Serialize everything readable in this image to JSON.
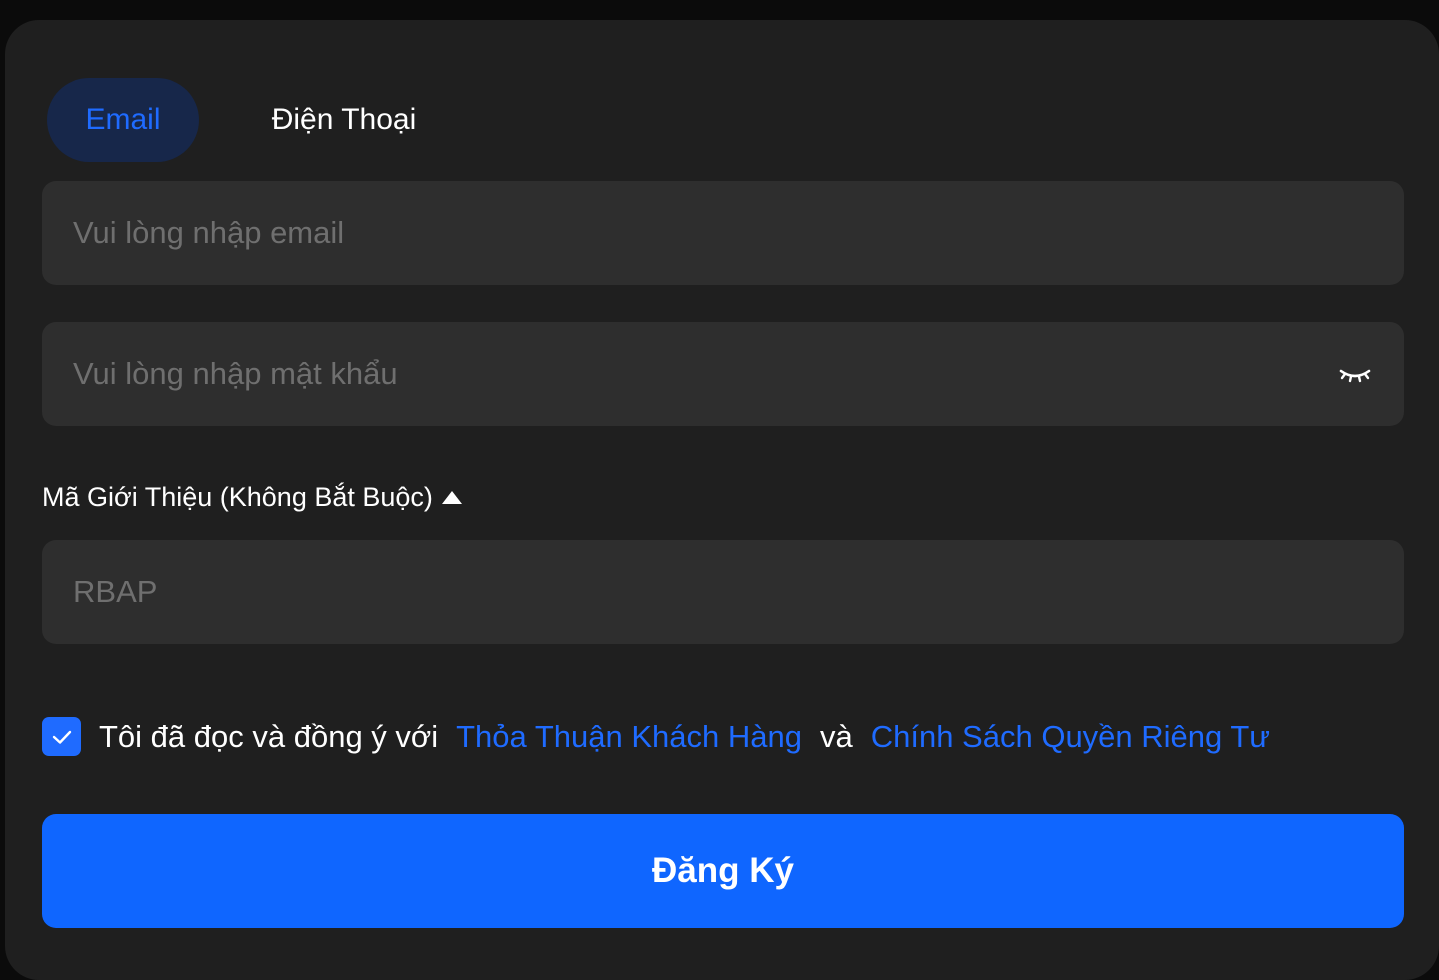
{
  "tabs": {
    "email_label": "Email",
    "phone_label": "Điện Thoại",
    "active": "email"
  },
  "form": {
    "email_placeholder": "Vui lòng nhập email",
    "email_value": "",
    "password_placeholder": "Vui lòng nhập mật khẩu",
    "password_value": "",
    "password_toggle_icon": "eye-closed-icon",
    "referral_label": "Mã Giới Thiệu (Không Bắt Buộc)",
    "referral_toggle_icon": "caret-up-icon",
    "referral_placeholder": "RBAP",
    "referral_value": ""
  },
  "agreement": {
    "checked": true,
    "prefix": "Tôi đã đọc và đồng ý với",
    "terms_link": "Thỏa Thuận Khách Hàng",
    "conjunction": "và",
    "privacy_link": "Chính Sách Quyền Riêng Tư"
  },
  "submit_label": "Đăng Ký",
  "colors": {
    "accent": "#1f6bff",
    "button": "#0f66ff",
    "card_bg": "#1f1f1f",
    "field_bg": "#2e2e2e",
    "active_tab_bg": "#17274a"
  }
}
